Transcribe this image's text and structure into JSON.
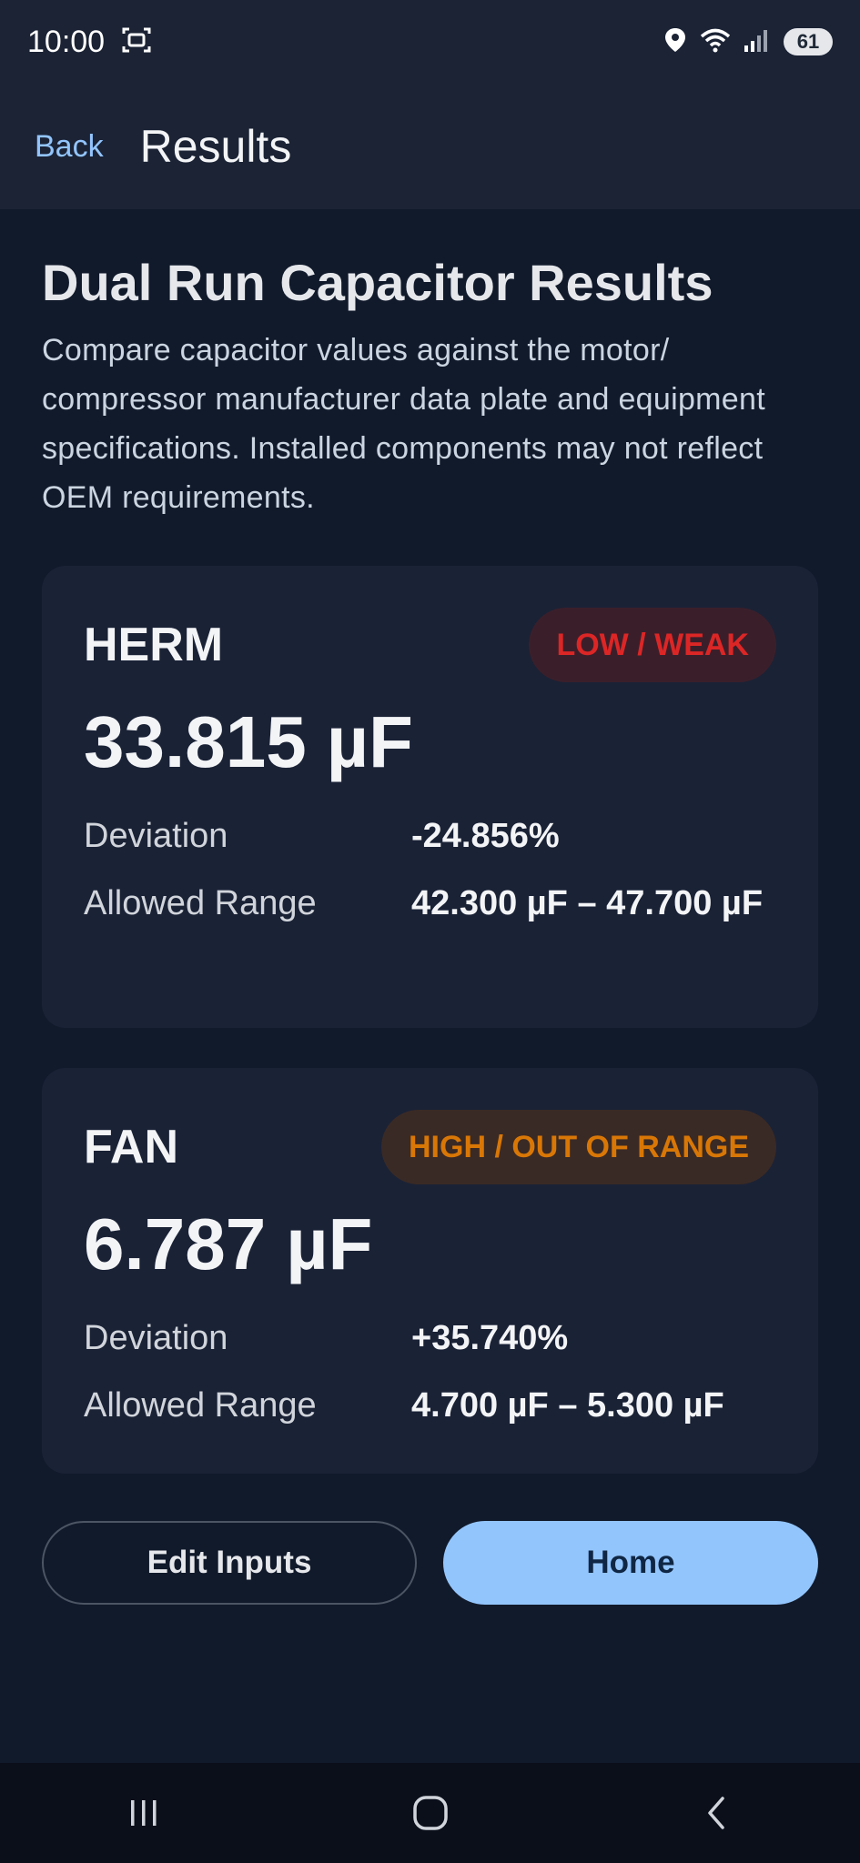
{
  "status_bar": {
    "time": "10:00",
    "battery": "61",
    "icons": [
      "screenshot-icon",
      "location-icon",
      "wifi-icon",
      "signal-icon",
      "battery-icon"
    ]
  },
  "app_bar": {
    "back_label": "Back",
    "title": "Results"
  },
  "page": {
    "heading": "Dual Run Capacitor Results",
    "description": "Compare capacitor values against the motor/ compressor manufacturer data plate and equipment specifications. Installed components may not reflect OEM requirements."
  },
  "cards": [
    {
      "label": "HERM",
      "status": "LOW / WEAK",
      "status_color": "#dc2626",
      "value": "33.815 µF",
      "deviation_label": "Deviation",
      "deviation": "-24.856%",
      "range_label": "Allowed Range",
      "range": "42.300 µF – 47.700 µF"
    },
    {
      "label": "FAN",
      "status": "HIGH / OUT OF RANGE",
      "status_color": "#d97706",
      "value": "6.787 µF",
      "deviation_label": "Deviation",
      "deviation": "+35.740%",
      "range_label": "Allowed Range",
      "range": "4.700 µF – 5.300 µF"
    }
  ],
  "actions": {
    "edit_label": "Edit Inputs",
    "home_label": "Home"
  },
  "nav_bar": {
    "icons": [
      "recent-apps-icon",
      "home-icon",
      "back-icon"
    ]
  },
  "colors": {
    "accent": "#93c5fd",
    "background": "#111a2b",
    "card": "#1a2236"
  }
}
